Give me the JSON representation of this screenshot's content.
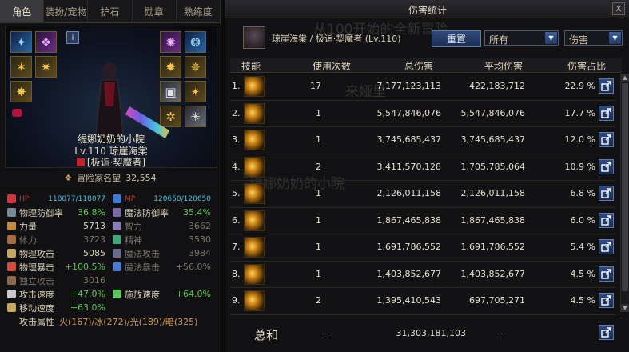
{
  "left": {
    "tabs": [
      "角色",
      "装扮/宠物",
      "护石",
      "勋章",
      "熟练度"
    ],
    "info_icon": "i",
    "char_name": "缇娜奶奶的小院",
    "level_line": "Lv.110 琼崖海棠",
    "job_line": "[极诣·契魔者]",
    "reputation_label": "冒险家名望",
    "reputation_value": "32,554",
    "stats": [
      [
        {
          "icon": "heart-icon",
          "color": "#d8323a",
          "label": "HP",
          "value": "118077/118077",
          "small": true
        },
        {
          "icon": "heart-icon",
          "color": "#3a7ad8",
          "label": "MP",
          "value": "120650/120650",
          "small": true
        }
      ],
      [
        {
          "icon": "shield-icon",
          "color": "#7a8a9a",
          "label": "物理防御率",
          "value": "36.8%",
          "green": true
        },
        {
          "icon": "shield-icon",
          "color": "#7a6aa8",
          "label": "魔法防御率",
          "value": "35.4%",
          "green": true
        }
      ],
      [
        {
          "icon": "fist-icon",
          "color": "#c88a3a",
          "label": "力量",
          "value": "5713"
        },
        {
          "icon": "brain-icon",
          "color": "#8a7ab8",
          "label": "智力",
          "value": "3662",
          "dim": true
        }
      ],
      [
        {
          "icon": "body-icon",
          "color": "#a86a3a",
          "label": "体力",
          "value": "3723",
          "dim": true
        },
        {
          "icon": "spirit-icon",
          "color": "#3aa87a",
          "label": "精神",
          "value": "3530",
          "dim": true
        }
      ],
      [
        {
          "icon": "sword-icon",
          "color": "#c8a85a",
          "label": "物理攻击",
          "value": "5085"
        },
        {
          "icon": "staff-icon",
          "color": "#6a6a8a",
          "label": "魔法攻击",
          "value": "3984",
          "dim": true
        }
      ],
      [
        {
          "icon": "crit-icon",
          "color": "#d84a3a",
          "label": "物理暴击",
          "value": "+100.5%",
          "green": true
        },
        {
          "icon": "crit-icon",
          "color": "#4a7ad8",
          "label": "魔法暴击",
          "value": "+56.0%",
          "dim": true
        }
      ],
      [
        {
          "icon": "atk-icon",
          "color": "#8a6a4a",
          "label": "独立攻击",
          "value": "3016",
          "dim": true
        },
        null
      ],
      [
        {
          "icon": "speed-icon",
          "color": "#c8c8c8",
          "label": "攻击速度",
          "value": "+47.0%",
          "green": true
        },
        {
          "icon": "cast-icon",
          "color": "#5ac85a",
          "label": "施放速度",
          "value": "+64.0%",
          "green": true
        }
      ],
      [
        {
          "icon": "boot-icon",
          "color": "#c8a85a",
          "label": "移动速度",
          "value": "+63.0%",
          "green": true
        },
        null
      ]
    ],
    "attr_label": "攻击属性",
    "attr_value": "火(167)/冰(272)/光(189)/暗(325)"
  },
  "right": {
    "title": "伤害统计",
    "close": "X",
    "char_line": "琼崖海棠 / 极诣·契魔者 (Lv.110)",
    "reset_label": "重置",
    "filter1": "所有",
    "filter2": "伤害",
    "headers": [
      "技能",
      "使用次数",
      "总伤害",
      "平均伤害",
      "伤害占比"
    ],
    "rows": [
      {
        "rank": "1.",
        "count": "17",
        "total": "7,177,123,113",
        "avg": "422,183,712",
        "pct": "22.9 %"
      },
      {
        "rank": "2.",
        "count": "1",
        "total": "5,547,846,076",
        "avg": "5,547,846,076",
        "pct": "17.7 %"
      },
      {
        "rank": "3.",
        "count": "1",
        "total": "3,745,685,437",
        "avg": "3,745,685,437",
        "pct": "12.0 %"
      },
      {
        "rank": "4.",
        "count": "2",
        "total": "3,411,570,128",
        "avg": "1,705,785,064",
        "pct": "10.9 %"
      },
      {
        "rank": "5.",
        "count": "1",
        "total": "2,126,011,158",
        "avg": "2,126,011,158",
        "pct": "6.8 %"
      },
      {
        "rank": "6.",
        "count": "1",
        "total": "1,867,465,838",
        "avg": "1,867,465,838",
        "pct": "6.0 %"
      },
      {
        "rank": "7.",
        "count": "1",
        "total": "1,691,786,552",
        "avg": "1,691,786,552",
        "pct": "5.4 %"
      },
      {
        "rank": "8.",
        "count": "1",
        "total": "1,403,852,677",
        "avg": "1,403,852,677",
        "pct": "4.5 %"
      },
      {
        "rank": "9.",
        "count": "2",
        "total": "1,395,410,543",
        "avg": "697,705,271",
        "pct": "4.5 %"
      }
    ],
    "total_label": "总和",
    "total_count": "–",
    "total_damage": "31,303,181,103",
    "total_avg": "–"
  }
}
